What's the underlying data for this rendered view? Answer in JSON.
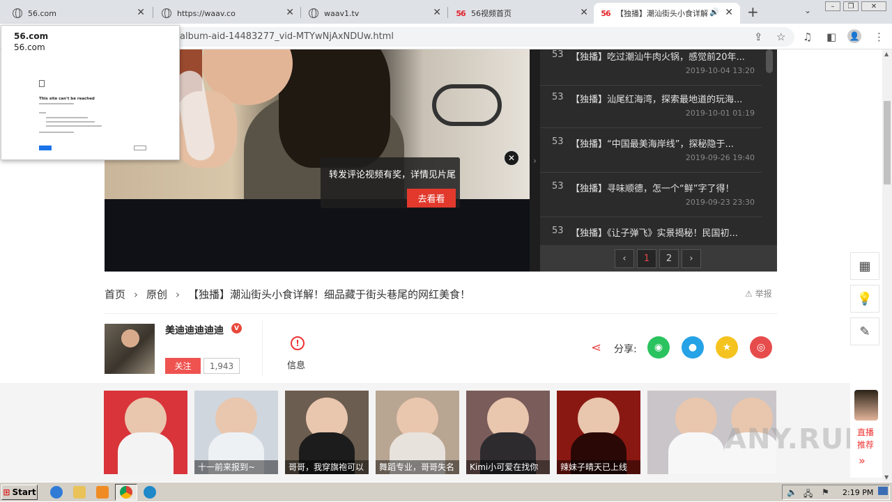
{
  "browser": {
    "tabs": [
      {
        "title": "56.com",
        "icon": "globe-icon"
      },
      {
        "title": "https://waav.co",
        "icon": "globe-icon"
      },
      {
        "title": "waav1.tv",
        "icon": "globe-icon"
      },
      {
        "title": "56视频首页",
        "icon": "56-logo-icon",
        "logo": "56"
      },
      {
        "title": "【独播】潮汕街头小食详解",
        "icon": "56-logo-icon",
        "logo": "56",
        "active": true
      }
    ],
    "new_tab": "+",
    "url": "album-aid-14483277_vid-MTYwNjAxNDUw.html"
  },
  "popup": {
    "title": "56.com",
    "url": "56.com",
    "error": "This site can't be reached"
  },
  "playlist": {
    "items": [
      {
        "num": "53",
        "title": "【独播】吃过潮汕牛肉火锅，感觉前20年...",
        "date": "2019-10-04 13:20"
      },
      {
        "num": "53",
        "title": "【独播】汕尾红海湾，探索最地道的玩海...",
        "date": "2019-10-01 01:19"
      },
      {
        "num": "53",
        "title": "【独播】“中国最美海岸线”，探秘隐于...",
        "date": "2019-09-26 19:40"
      },
      {
        "num": "53",
        "title": "【独播】寻味顺德，怎一个“鲜”字了得！",
        "date": "2019-09-23 23:30"
      },
      {
        "num": "53",
        "title": "【独播】《让子弹飞》实景揭秘！民国初...",
        "date": ""
      }
    ],
    "pager": {
      "prev": "‹",
      "pages": [
        "1",
        "2"
      ],
      "current": "1",
      "next": "›"
    }
  },
  "promo": {
    "text": "转发评论视频有奖，详情见片尾",
    "button": "去看看",
    "close": "✕"
  },
  "breadcrumb": {
    "home": "首页",
    "category": "原创",
    "title": "【独播】潮汕街头小食详解！细品藏于街头巷尾的网红美食！"
  },
  "report": "举报",
  "uploader": {
    "name": "美迪迪迪迪迪",
    "badge": "V",
    "follow": "关注",
    "followers": "1,943"
  },
  "info": {
    "label": "信息",
    "icon": "!"
  },
  "share": {
    "label": "分享:",
    "targets": [
      {
        "name": "wechat",
        "color": "#2ac35f"
      },
      {
        "name": "qq",
        "color": "#26a2e6"
      },
      {
        "name": "qzone",
        "color": "#f5c31f"
      },
      {
        "name": "weibo",
        "color": "#e74c4c"
      }
    ]
  },
  "recommendations": [
    {
      "caption": "",
      "color": "#d8343a"
    },
    {
      "caption": "十一前来报到~",
      "color": "#cfd6de"
    },
    {
      "caption": "哥哥，我穿旗袍可以",
      "color": "#6b5d4f"
    },
    {
      "caption": "舞蹈专业，哥哥失名",
      "color": "#b8a592"
    },
    {
      "caption": "Kimi小可爱在找你",
      "color": "#7a5d5a"
    },
    {
      "caption": "辣妹子晴天已上线",
      "color": "#8a1812"
    },
    {
      "caption": "",
      "color": "#c9c5c8"
    }
  ],
  "live": {
    "line1": "直播",
    "line2": "推荐",
    "arrow": "»"
  },
  "float_buttons": [
    "qr-code-icon",
    "lightbulb-icon",
    "edit-icon"
  ],
  "watermark": "ANY.RUN",
  "taskbar": {
    "start": "Start",
    "time": "2:19 PM"
  }
}
